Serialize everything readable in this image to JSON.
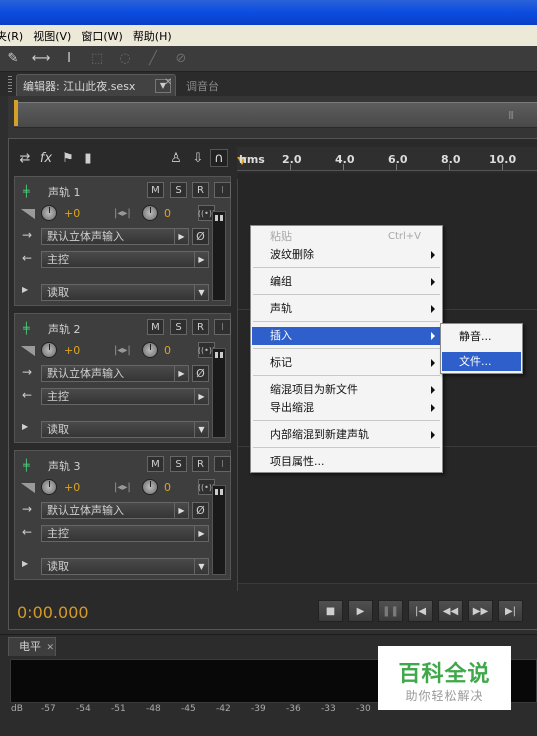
{
  "menu": [
    "夹(R)",
    "视图(V)",
    "窗口(W)",
    "帮助(H)"
  ],
  "tabs": {
    "editor": "编辑器: 江山此夜.sesx",
    "mixer": "调音台"
  },
  "ruler": {
    "unit": "hms",
    "ticks": [
      "2.0",
      "4.0",
      "6.0",
      "8.0",
      "10.0"
    ]
  },
  "toolbar_icons": [
    "heal-brush-icon",
    "time-select-icon",
    "text-cursor-icon",
    "marquee-icon",
    "lasso-icon",
    "brush-icon",
    "spot-heal-icon"
  ],
  "tracks": [
    {
      "name": "声轨 1",
      "volume": "+0",
      "pan": "0",
      "input": "默认立体声输入",
      "output": "主控",
      "mode": "读取"
    },
    {
      "name": "声轨 2",
      "volume": "+0",
      "pan": "0",
      "input": "默认立体声输入",
      "output": "主控",
      "mode": "读取"
    },
    {
      "name": "声轨 3",
      "volume": "+0",
      "pan": "0",
      "input": "默认立体声输入",
      "output": "主控",
      "mode": "读取"
    }
  ],
  "track_buttons": {
    "mute": "M",
    "solo": "S",
    "record": "R",
    "input": "I"
  },
  "timecode": "0:00.000",
  "context_menu": {
    "paste": "粘贴",
    "paste_shortcut": "Ctrl+V",
    "ripple_delete": "波纹删除",
    "group": "编组",
    "track": "声轨",
    "insert": "插入",
    "marker": "标记",
    "mixdown_new_file": "缩混项目为新文件",
    "export_mixdown": "导出缩混",
    "bounce_new_track": "内部缩混到新建声轨",
    "project_properties": "项目属性..."
  },
  "submenu": {
    "silence": "静音...",
    "file": "文件..."
  },
  "levels": {
    "tab": "电平",
    "scale": [
      "dB",
      "-57",
      "-54",
      "-51",
      "-48",
      "-45",
      "-42",
      "-39",
      "-36",
      "-33",
      "-30"
    ]
  },
  "watermark": {
    "title": "百科全说",
    "subtitle": "助你轻松解决"
  }
}
